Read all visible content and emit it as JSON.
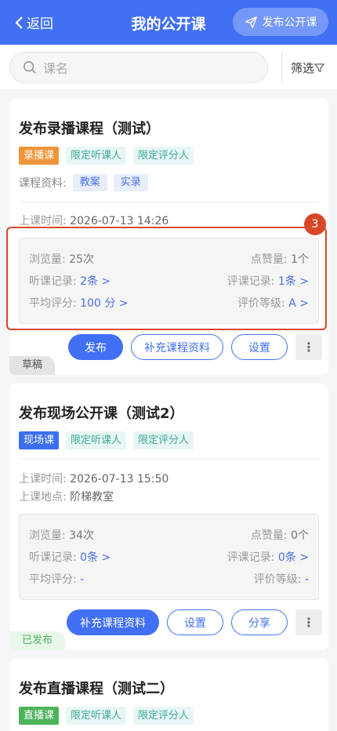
{
  "header": {
    "back_label": "返回",
    "title": "我的公开课",
    "publish_label": "发布公开课"
  },
  "search": {
    "placeholder": "课名",
    "filter_label": "筛选"
  },
  "colors": {
    "primary": "#4170f5",
    "highlight": "#d9472b"
  },
  "annotation": {
    "badge": "3"
  },
  "courses": [
    {
      "title": "发布录播课程（测试）",
      "type_tag": "录播课",
      "tags": [
        "限定听课人",
        "限定评分人"
      ],
      "materials_label": "课程资料:",
      "materials": [
        "教案",
        "实录"
      ],
      "time_label": "上课时间:",
      "time": "2026-07-13 14:26",
      "views_label": "浏览量:",
      "views": "25次",
      "likes_label": "点赞量:",
      "likes": "1个",
      "listen_label": "听课记录:",
      "listen": "2条 >",
      "review_label": "评课记录:",
      "review": "1条 >",
      "avg_label": "平均评分:",
      "avg": "100 分 >",
      "grade_label": "评价等级:",
      "grade": "A >",
      "buttons": [
        "发布",
        "补充课程资料",
        "设置"
      ],
      "more": "⋮",
      "status": "草稿"
    },
    {
      "title": "发布现场公开课（测试2）",
      "type_tag": "现场课",
      "tags": [
        "限定听课人",
        "限定评分人"
      ],
      "time_label": "上课时间:",
      "time": "2026-07-13 15:50",
      "place_label": "上课地点:",
      "place": "阶梯教室",
      "views_label": "浏览量:",
      "views": "34次",
      "likes_label": "点赞量:",
      "likes": "0个",
      "listen_label": "听课记录:",
      "listen": "0条 >",
      "review_label": "评课记录:",
      "review": "0条 >",
      "avg_label": "平均评分:",
      "avg": "-",
      "grade_label": "评价等级:",
      "grade": "-",
      "buttons": [
        "补充课程资料",
        "设置",
        "分享"
      ],
      "more": "⋮",
      "status": "已发布"
    },
    {
      "title": "发布直播课程（测试二）",
      "type_tag": "直播课",
      "tags": [
        "限定听课人",
        "限定评分人"
      ]
    }
  ]
}
